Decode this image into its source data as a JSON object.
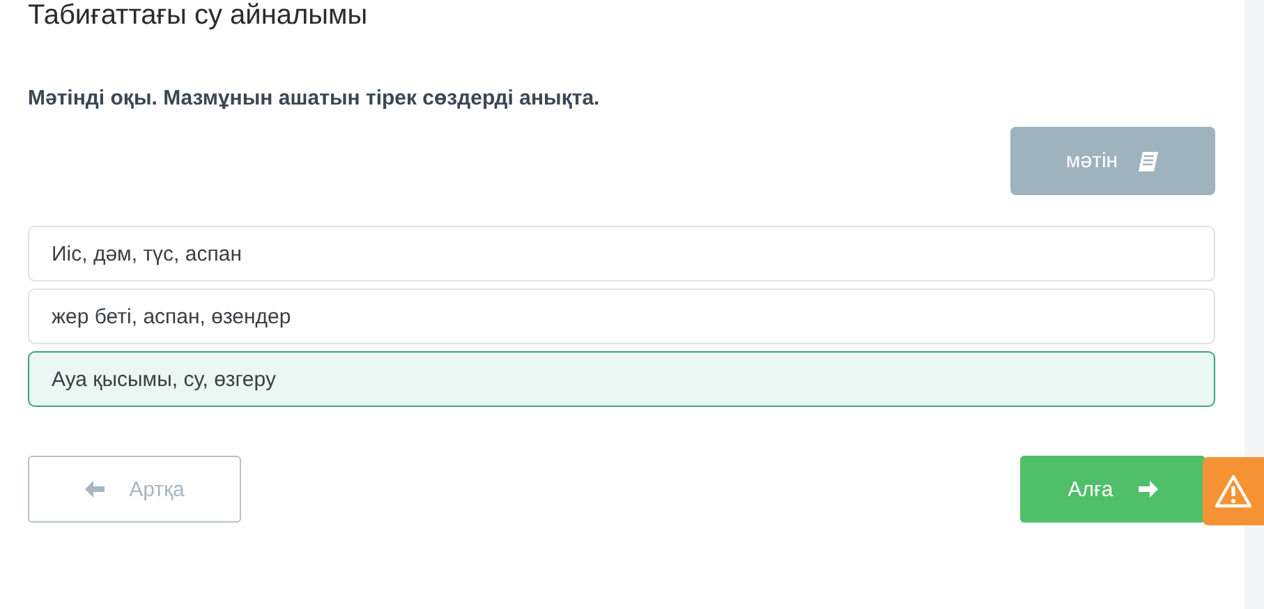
{
  "title": "Табиғаттағы су айналымы",
  "instruction": "Мәтінді оқы. Мазмұнын ашатын тірек сөздерді анықта.",
  "text_button": {
    "label": "мәтін"
  },
  "options": [
    {
      "label": "Иіс, дәм, түс, аспан",
      "selected": false
    },
    {
      "label": "жер беті, аспан, өзендер",
      "selected": false
    },
    {
      "label": "Ауа қысымы, су, өзгеру",
      "selected": true
    }
  ],
  "back_button": {
    "label": "Артқа"
  },
  "next_button": {
    "label": "Алға"
  },
  "report_button": {
    "kind": "warning"
  }
}
